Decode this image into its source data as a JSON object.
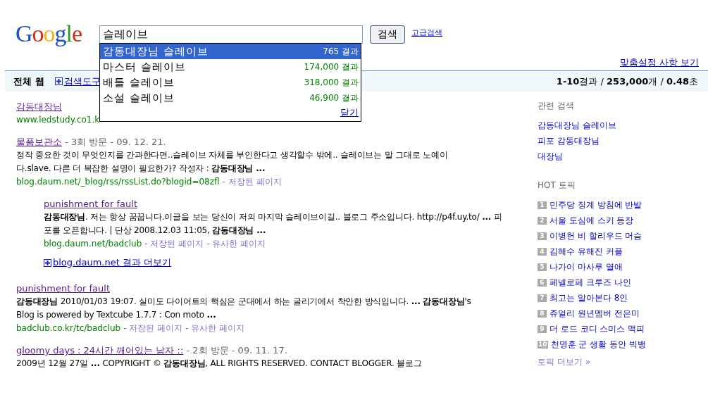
{
  "logo": "Google",
  "search": {
    "query": "슬레이브"
  },
  "search_button": "검색",
  "advanced_link": "고급검색",
  "suggestions": [
    {
      "text": "감동대장님 슬레이브",
      "count": "765 결과",
      "selected": true
    },
    {
      "text": "마스터 슬레이브",
      "count": "174,000 결과",
      "selected": false
    },
    {
      "text": "배틀 슬레이브",
      "count": "318,000 결과",
      "selected": false
    },
    {
      "text": "소설 슬레이브",
      "count": "46,900 결과",
      "selected": false
    }
  ],
  "close_link": "닫기",
  "preferences_link": "맞춤설정 사항 보기",
  "toolbar": {
    "label": "전체 웹",
    "tools_link": "검색도구",
    "stats": "**1-10**결과 / **253,000**개 / **0.48**초"
  },
  "results": [
    {
      "kind": "main",
      "title": "감동대장님",
      "url": "www.ledstudy.co1.k"
    },
    {
      "kind": "main",
      "title": "물품보관소",
      "meta": " - 3회 방문 - 09. 12. 21.",
      "snippet": "정작 중요한 것이 무엇인지를 간과한다면..슬레이브 자체를 부인한다고 생각할수 밖에.. 슬레이브는 말 그대로 노예이다.slave. 다른 더 복잡한 설명이 필요한가? 작성자 : **감동대장님 ...**",
      "url": "blog.daum.net/_blog/rss/rssList.do?blogid=08zfl",
      "links": [
        "- 저장된 페이지"
      ]
    },
    {
      "kind": "nested",
      "title": "punishment for fault",
      "snippet": "**감동대장님**. 저는 항상 꿈꿉니다.이글을 보는 당신이 저의 마지막 슬레이브이길.. 블로그 주소입니다. http://p4f.uy.to/ **...** 피포를 오픈합니다. | 단상 2008.12.03 11:05, **감동대장님 ...**",
      "url": "blog.daum.net/badclub",
      "links": [
        "- 저장된 페이지",
        "- 유사한 페이지"
      ]
    },
    {
      "kind": "more",
      "title": "blog.daum.net 결과 더보기"
    },
    {
      "kind": "main",
      "title": "punishment for fault",
      "snippet": "**감동대장님** 2010/01/03 19:07. 실미도 다이어트의 핵심은 군대에서 하는 굴리기에서 착안한 방식입니다. **...** **감동대장님**'s Blog is powered by Textcube 1.7.7 : Con moto **...**",
      "url": "badclub.co.kr/tc/badclub",
      "links": [
        "- 저장된 페이지",
        "- 유사한 페이지"
      ]
    },
    {
      "kind": "main",
      "title": "gloomy days : 24시간 깨어있는 남자 ::",
      "meta": " - 2회 방문 - 09. 11. 17.",
      "snippet": "2009년 12월 27일 **...** COPYRIGHT © **감동대장님**, ALL RIGHTS RESERVED. CONTACT BLOGGER. 블로그"
    }
  ],
  "related_title": "관련 검색",
  "related": [
    "감동대장님 슬레이브",
    "피포 감동대장님",
    "대장님"
  ],
  "hot_title": "HOT 토픽",
  "hot_topics": [
    {
      "rank": "1",
      "text": "민주당 징계 방침에 반발"
    },
    {
      "rank": "2",
      "text": "서울 도심에 스키 등장"
    },
    {
      "rank": "3",
      "text": "이병헌 비 할리우드 머슴"
    },
    {
      "rank": "4",
      "text": "김혜수 유해진 커플"
    },
    {
      "rank": "5",
      "text": "나가이 마사루 열애"
    },
    {
      "rank": "6",
      "text": "페넬로페 크루즈 나인"
    },
    {
      "rank": "7",
      "text": "최고는 알아본다 8인"
    },
    {
      "rank": "8",
      "text": "쥬얼리 원년멤버 전은미"
    },
    {
      "rank": "9",
      "text": "더 로드 코디 스미스 맥피"
    },
    {
      "rank": "10",
      "text": "천명훈 군 생활 동안 빅뱅"
    }
  ],
  "more_topics": "토픽 더보기 »"
}
